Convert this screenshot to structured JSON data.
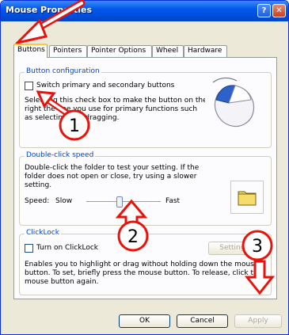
{
  "window": {
    "title": "Mouse Properties",
    "help_label": "?",
    "close_label": "✕"
  },
  "tabs": [
    {
      "label": "Buttons"
    },
    {
      "label": "Pointers"
    },
    {
      "label": "Pointer Options"
    },
    {
      "label": "Wheel"
    },
    {
      "label": "Hardware"
    }
  ],
  "button_config": {
    "group_label": "Button configuration",
    "checkbox_label": "Switch primary and secondary buttons",
    "checked": false,
    "description_lines": [
      "Selecting this check box to make the button on the",
      "right the one you use for primary functions such",
      "as selecting and dragging."
    ]
  },
  "double_click": {
    "group_label": "Double-click speed",
    "description_lines": [
      "Double-click the folder to test your setting. If the",
      "folder does not open or close, try using a slower",
      "setting."
    ],
    "speed_label": "Speed:",
    "slow_label": "Slow",
    "fast_label": "Fast",
    "speed_value": 0.45
  },
  "clicklock": {
    "group_label": "ClickLock",
    "checkbox_label": "Turn on ClickLock",
    "checked": false,
    "settings_label": "Settings...",
    "description_lines": [
      "Enables you to highlight or drag without holding down the mouse",
      "button. To set, briefly press the mouse button. To release, click the",
      "mouse button again."
    ]
  },
  "footer": {
    "ok": "OK",
    "cancel": "Cancel",
    "apply": "Apply"
  },
  "annotations": {
    "one": "1",
    "two": "2",
    "three": "3"
  },
  "colors": {
    "arrow": "#e8140c",
    "title_blue": "#0058ee",
    "group_label": "#0046d5"
  }
}
